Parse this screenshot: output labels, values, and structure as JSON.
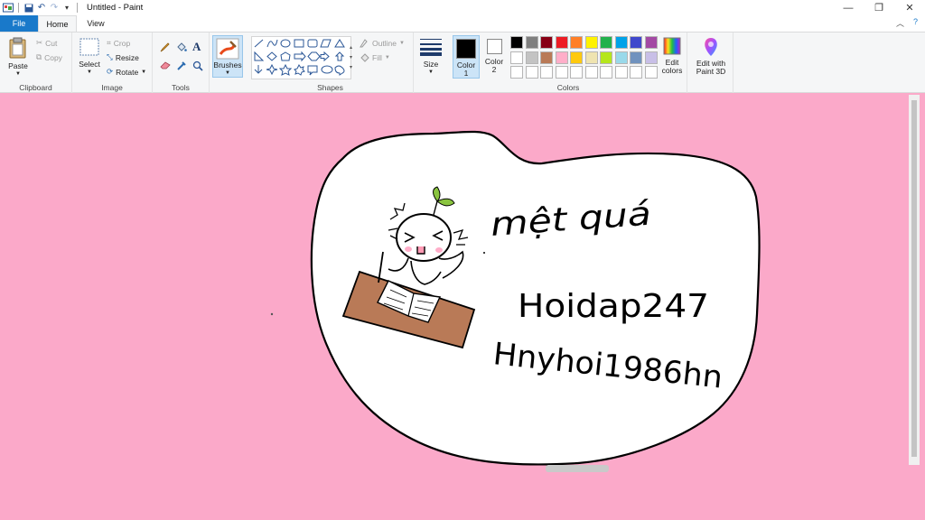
{
  "window": {
    "title": "Untitled - Paint",
    "controls": [
      "minimize",
      "restore",
      "close"
    ]
  },
  "tabs": {
    "file": "File",
    "home": "Home",
    "view": "View"
  },
  "ribbon": {
    "clipboard": {
      "label": "Clipboard",
      "paste": "Paste",
      "cut": "Cut",
      "copy": "Copy"
    },
    "image": {
      "label": "Image",
      "select": "Select",
      "crop": "Crop",
      "resize": "Resize",
      "rotate": "Rotate"
    },
    "tools": {
      "label": "Tools"
    },
    "brushes": {
      "label": "Brushes"
    },
    "shapes": {
      "label": "Shapes",
      "outline": "Outline",
      "fill": "Fill"
    },
    "size": {
      "label": "Size"
    },
    "colors": {
      "label": "Colors",
      "color1_label": "Color",
      "color1_num": "1",
      "color2_label": "Color",
      "color2_num": "2",
      "color1": "#000000",
      "color2": "#ffffff",
      "edit_label1": "Edit",
      "edit_label2": "colors",
      "palette_row1": [
        "#000000",
        "#7f7f7f",
        "#880015",
        "#ed1c24",
        "#ff7f27",
        "#fff200",
        "#22b14c",
        "#00a2e8",
        "#3f48cc",
        "#a349a4"
      ],
      "palette_row2": [
        "#ffffff",
        "#c3c3c3",
        "#b97a57",
        "#ffaec9",
        "#ffc90e",
        "#efe4b0",
        "#b5e61d",
        "#99d9ea",
        "#7092be",
        "#c8bfe7"
      ],
      "palette_row3": [
        "#ffffff",
        "#ffffff",
        "#ffffff",
        "#ffffff",
        "#ffffff",
        "#ffffff",
        "#ffffff",
        "#ffffff",
        "#ffffff",
        "#ffffff"
      ]
    },
    "paint3d": {
      "line1": "Edit with",
      "line2": "Paint 3D"
    }
  },
  "canvas": {
    "background": "#fba9c9",
    "bubble_fill": "#ffffff",
    "desk_color": "#b97a57",
    "sprout_color": "#8ac43f",
    "blush_color": "#ffaec9",
    "handwriting": {
      "line1": "mệt quá",
      "line2": "Hoidap247",
      "line3": "Hnyhoi1986hn"
    }
  }
}
